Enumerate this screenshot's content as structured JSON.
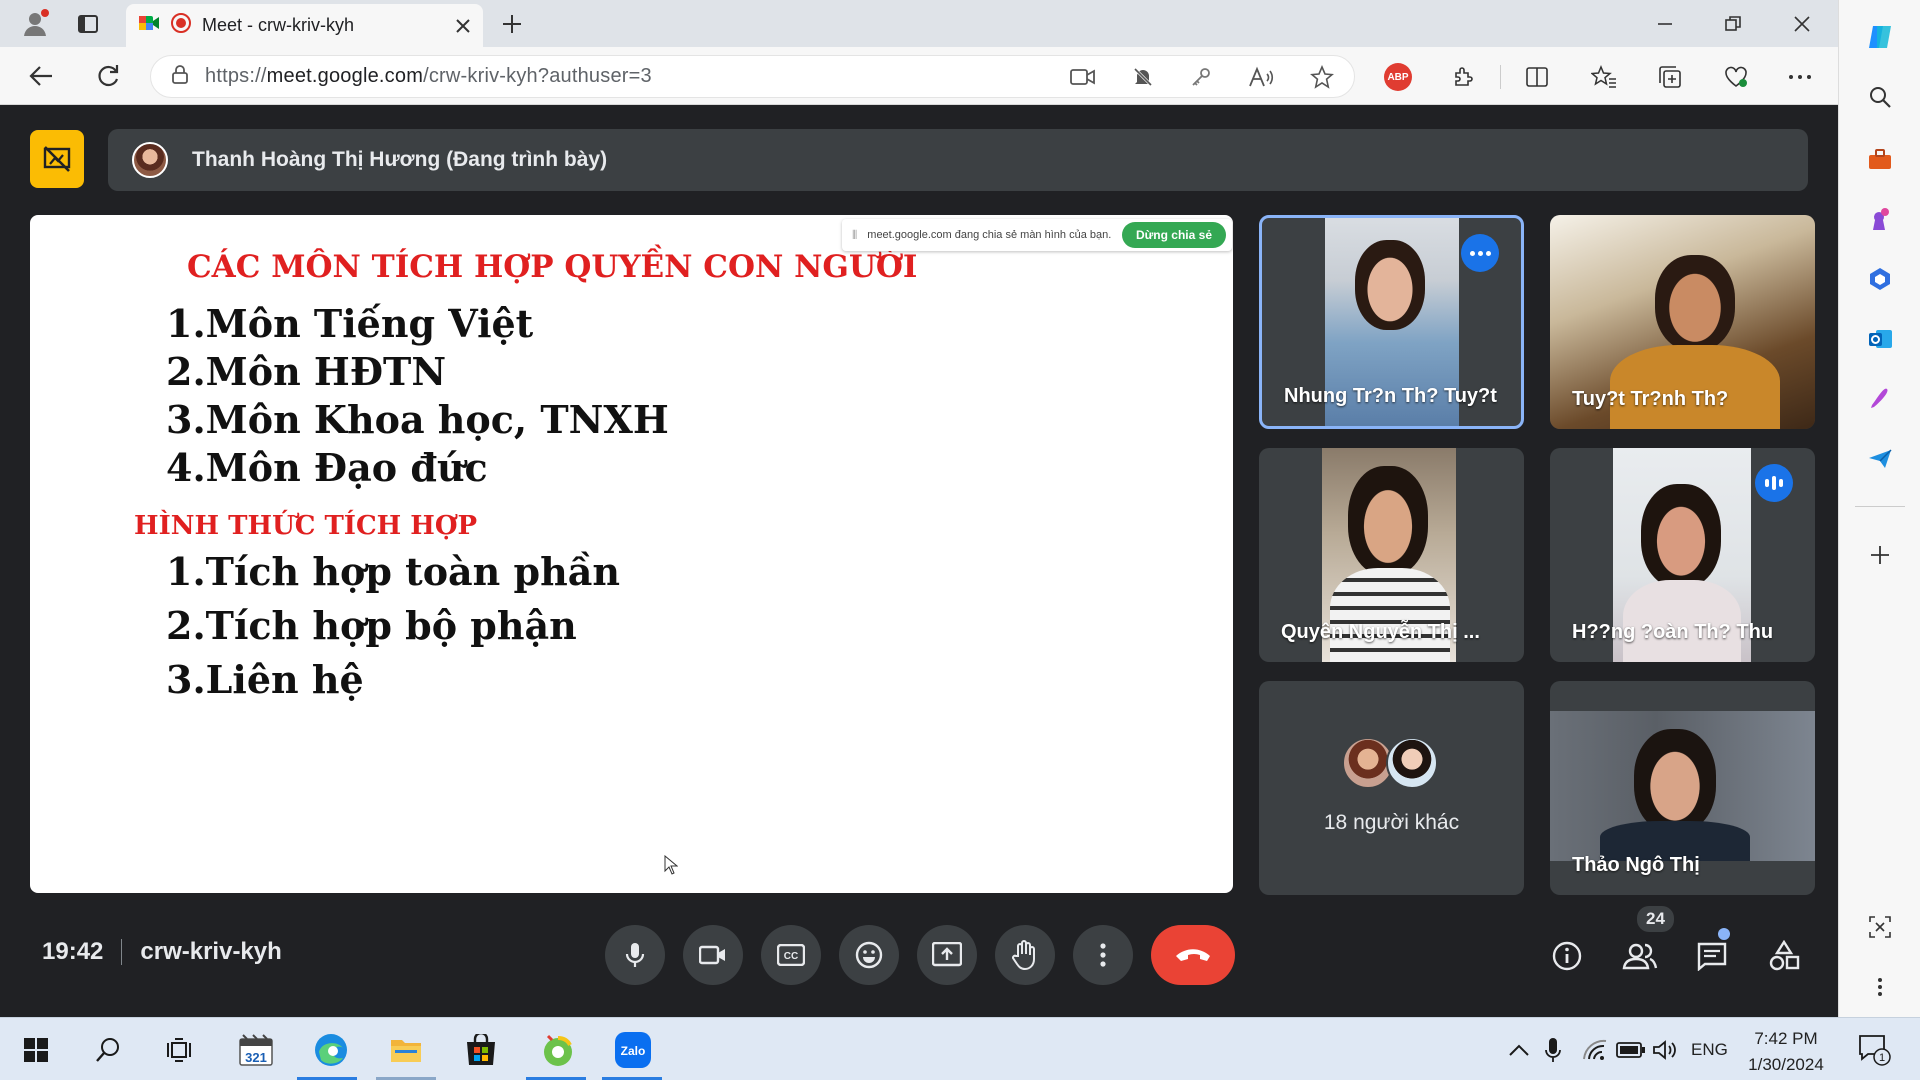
{
  "browser": {
    "tab_title": "Meet - crw-kriv-kyh",
    "url_prefix": "https://",
    "url_host": "meet.google.com",
    "url_path": "/crw-kriv-kyh?authuser=3",
    "extension_badge": "ABP"
  },
  "meet": {
    "presenter_name": "Thanh Hoàng Thị Hương (Đang trình bày)",
    "share_notice": "meet.google.com đang chia sẻ màn hình của bạn.",
    "stop_share_label": "Dừng chia sẻ",
    "slide": {
      "title": "CÁC MÔN TÍCH HỢP QUYỀN CON NGƯỜI",
      "items_top": [
        "1.Môn Tiếng Việt",
        "2.Môn HĐTN",
        "3.Môn Khoa học, TNXH",
        "4.Môn Đạo đức"
      ],
      "subtitle": "HÌNH THỨC TÍCH HỢP",
      "items_bottom": [
        "1.Tích hợp toàn phần",
        "2.Tích hợp bộ phận",
        "3.Liên hệ"
      ]
    },
    "participants": [
      {
        "name": "Nhung Tr?n Th? Tuy?t"
      },
      {
        "name": "Tuy?t Tr?nh Th?"
      },
      {
        "name": "Quyên Nguyễn Thị ..."
      },
      {
        "name": "H??ng ?oàn Th? Thu"
      },
      {
        "name": "Thảo Ngô Thị"
      }
    ],
    "others_label": "18 người khác",
    "time": "19:42",
    "meeting_code": "crw-kriv-kyh",
    "people_count": "24"
  },
  "taskbar": {
    "language": "ENG",
    "clock_time": "7:42 PM",
    "clock_date": "1/30/2024",
    "notification_count": "1",
    "calendar_day": "321"
  },
  "colors": {
    "meet_bg": "#202124",
    "tile_bg": "#3c4043",
    "end_call": "#ea4335",
    "active_border": "#8ab4f8",
    "slide_red": "#e02020",
    "present_badge": "#fbbc04"
  }
}
